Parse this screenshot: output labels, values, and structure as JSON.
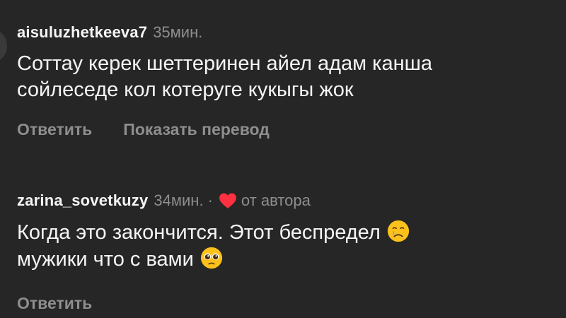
{
  "comments": [
    {
      "username": "aisuluzhetkeeva7",
      "time": "35мин.",
      "text_lines": [
        "Соттау керек шеттеринен айел адам канша",
        "сойлеседе кол котеруге кукыгы жок"
      ],
      "actions": [
        "Ответить",
        "Показать перевод"
      ]
    },
    {
      "username": "zarina_sovetkuzy",
      "time": "34мин.",
      "separator": "·",
      "author_label": "от автора",
      "text_lines": [
        "Когда это закончится. Этот беспредел",
        "мужики что с вами"
      ],
      "emojis": [
        "crying-face-icon",
        "pleading-face-icon"
      ],
      "actions": [
        "Ответить"
      ]
    }
  ],
  "colors": {
    "background": "#262626",
    "text": "#f5f5f5",
    "secondary": "#8e8e8e",
    "heart": "#ff3040"
  }
}
